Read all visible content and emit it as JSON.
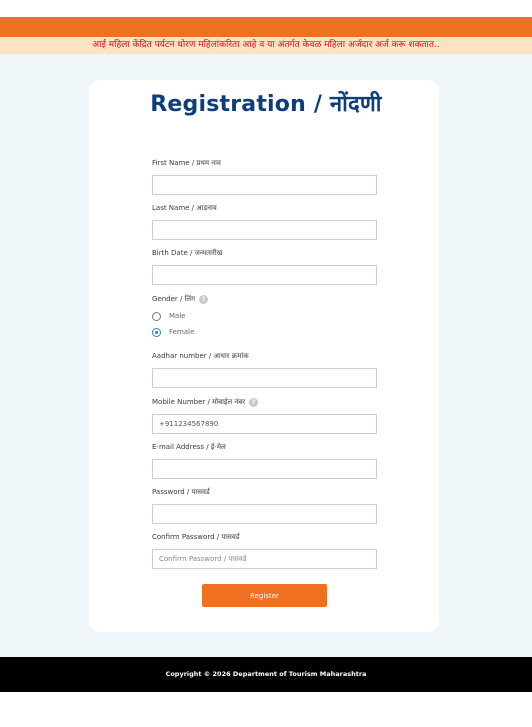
{
  "notice": "आई महिला केंद्रित पर्यटन धोरण महिलांकरिता आहे व या अंतर्गत केवळ महिला अर्जदार अर्ज करू शकतात..",
  "form": {
    "title": "Registration / नोंदणी",
    "first_name_label": "First Name / प्रथम नाव",
    "last_name_label": "Last Name / आडनाव",
    "birth_date_label": "Birth Date / जन्मतारीख",
    "gender_label": "Gender / लिंग",
    "gender_options": [
      {
        "label": "Male",
        "selected": false
      },
      {
        "label": "Female",
        "selected": true
      }
    ],
    "aadhar_label": "Aadhar number / आधार क्रमांक",
    "mobile_label": "Mobile Number / मोबाईल नंबर",
    "mobile_value": "+911234567890",
    "email_label": "E-mail Address / ई-मेल",
    "password_label": "Password / पासवर्ड",
    "confirm_password_label": "Confirm Password / पासवर्ड",
    "confirm_password_placeholder": "Confirm Password / पासवर्ड",
    "help_glyph": "?",
    "register_label": "Register"
  },
  "footer": "Copyright © 2026 Department of Tourism Maharashtra",
  "colors": {
    "accent": "#f07022",
    "title": "#0e3d7e",
    "notice_text": "#d3101a",
    "notice_bg": "#fde3c6",
    "page_bg": "#eef6f9",
    "footer_bg": "#000000",
    "radio_selected": "#2b7fd4"
  }
}
